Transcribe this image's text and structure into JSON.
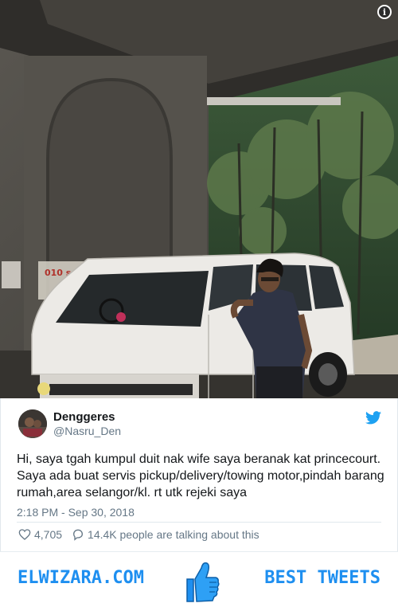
{
  "photo": {
    "plate_text": "010 s",
    "info_icon": "info-icon",
    "info_label": "i"
  },
  "tweet": {
    "display_name": "Denggeres",
    "handle": "@Nasru_Den",
    "text": "Hi, saya tgah kumpul duit nak wife saya beranak kat princecourt. Saya ada buat servis pickup/delivery/towing motor,pindah barang rumah,area selangor/kl. rt utk rejeki saya",
    "timestamp": "2:18 PM - Sep 30, 2018",
    "likes": "4,705",
    "talking": "14.4K people are talking about this",
    "brand_icon": "twitter-bird-icon"
  },
  "banner": {
    "left_text": "ELWIZARA.COM",
    "right_text": "BEST TWEETS",
    "icon": "thumbs-up-icon"
  },
  "colors": {
    "twitter_blue": "#1da1f2",
    "brand_blue": "#1e8ff0",
    "muted_text": "#657786"
  }
}
